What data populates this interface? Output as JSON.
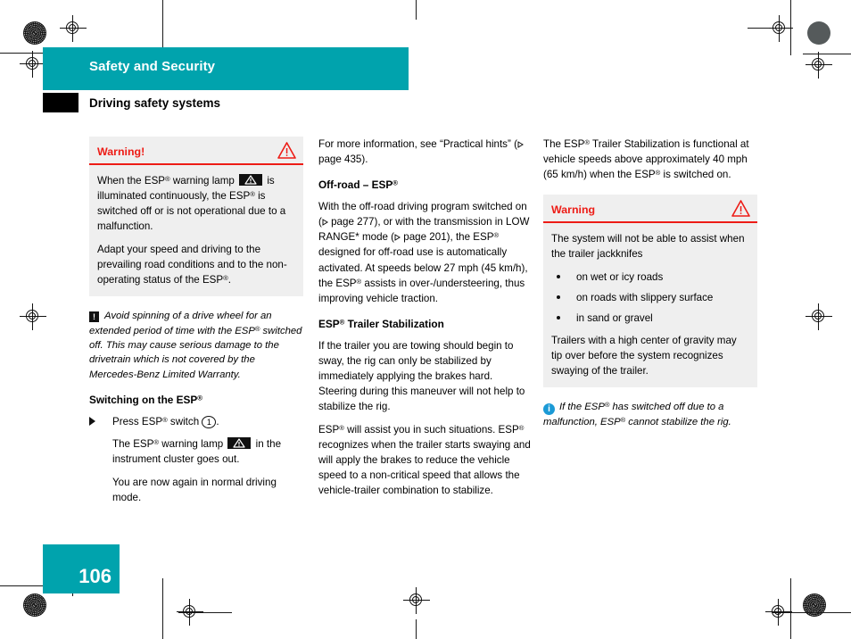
{
  "header": {
    "band_title": "Safety and Security",
    "section_title": "Driving safety systems"
  },
  "page_number": "106",
  "colors": {
    "brand_teal": "#00a3ad",
    "warning_red": "#ed1c16",
    "note_blue": "#1b9ad6",
    "box_gray": "#efefef"
  },
  "column_left": {
    "warning_box": {
      "title": "Warning!",
      "icon": "warning-triangle-icon",
      "paragraph_1_before_lamp": "When the ESP",
      "paragraph_1_sup": "®",
      "paragraph_1_mid": " warning lamp ",
      "paragraph_1_after_lamp": " is illuminated continuously, the ESP",
      "paragraph_1_end": " is switched off or is not operational due to a malfunction.",
      "paragraph_2_start": "Adapt your speed and driving to the prevailing road conditions and to the non-operating status of the ESP",
      "paragraph_2_end": "."
    },
    "note": {
      "icon": "exclamation-box-icon",
      "icon_glyph": "!",
      "text_start": "Avoid spinning of a drive wheel for an extended period of time with the ESP",
      "sup": "®",
      "text_end": " switched off. This may cause serious damage to the drivetrain which is not covered by the Mercedes-Benz Limited Warranty."
    },
    "heading": "Switching on the ESP",
    "heading_sup": "®",
    "step_1_before": "Press ESP",
    "step_1_sup": "®",
    "step_1_mid": " switch ",
    "step_1_callout": "1",
    "step_1_end": ".",
    "step_sub_1_before": "The ESP",
    "step_sub_1_sup": "®",
    "step_sub_1_mid": " warning lamp ",
    "step_sub_1_end": " in the instrument cluster goes out.",
    "step_sub_2": "You are now again in normal driving mode."
  },
  "column_middle": {
    "intro_start": "For more information, see “Practical hints” (",
    "intro_page_label": "page 435",
    "intro_end": ").",
    "heading_offroad_start": "Off-road – ESP",
    "heading_offroad_sup": "®",
    "offroad_p1_a": "With the off-road driving program switched on (",
    "offroad_p1_page1": "page 277",
    "offroad_p1_b": "), or with the transmission in LOW RANGE* mode (",
    "offroad_p1_page2": "page 201",
    "offroad_p1_c": "), the ESP",
    "offroad_p1_sup1": "®",
    "offroad_p1_d": " designed for off-road use is automatically activated. At speeds below 27 mph (45 km/h), the ESP",
    "offroad_p1_sup2": "®",
    "offroad_p1_e": " assists in over-/understeering, thus improving vehicle traction.",
    "heading_trailer_start": "ESP",
    "heading_trailer_sup": "®",
    "heading_trailer_end": " Trailer Stabilization",
    "trailer_p1": "If the trailer you are towing should begin to sway, the rig can only be stabilized by immediately applying the brakes hard. Steering during this maneuver will not help to stabilize the rig.",
    "trailer_p2_a": "ESP",
    "trailer_p2_sup1": "®",
    "trailer_p2_b": " will assist you in such situations. ESP",
    "trailer_p2_sup2": "®",
    "trailer_p2_c": " recognizes when the trailer starts swaying and will apply the brakes to reduce the vehicle speed to a non-critical speed that allows the vehicle-trailer combination to stabilize."
  },
  "column_right": {
    "intro_a": "The ESP",
    "intro_sup1": "®",
    "intro_b": " Trailer Stabilization is functional at vehicle speeds above approximately 40 mph (65 km/h) when the ESP",
    "intro_sup2": "®",
    "intro_c": " is switched on.",
    "warning_box": {
      "title": "Warning",
      "icon": "warning-triangle-icon",
      "intro": "The system will not be able to assist when the trailer jackknifes",
      "bullets": [
        "on wet or icy roads",
        "on roads with slippery surface",
        "in sand or gravel"
      ],
      "outro": "Trailers with a high center of gravity may tip over before the system recognizes swaying of the trailer."
    },
    "note": {
      "icon": "info-circle-icon",
      "icon_glyph": "i",
      "text_a": "If the ESP",
      "sup1": "®",
      "text_b": " has switched off due to a malfunction, ESP",
      "sup2": "®",
      "text_c": " cannot stabilize the rig."
    }
  }
}
